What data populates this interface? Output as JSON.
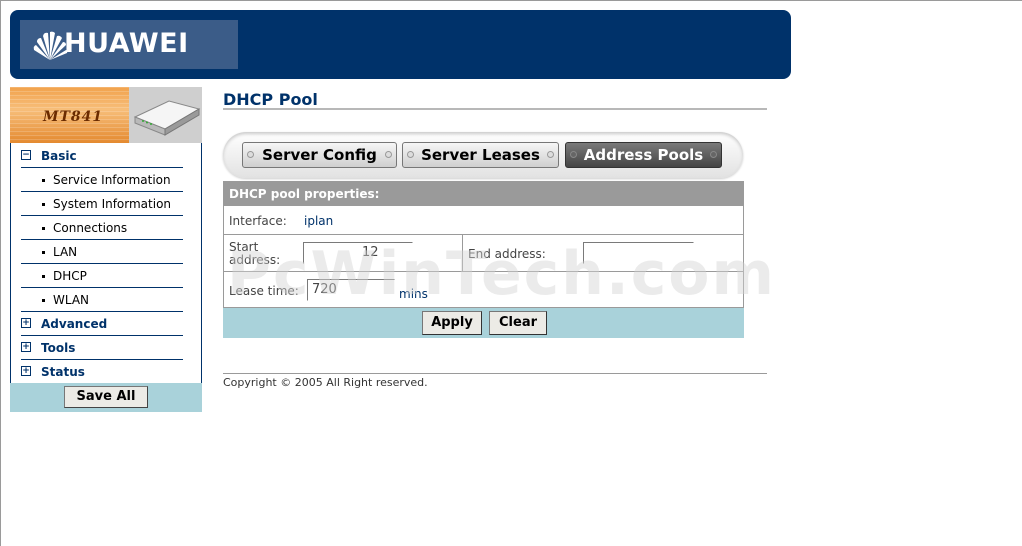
{
  "header": {
    "brand": "HUAWEI"
  },
  "device": {
    "model": "MT841"
  },
  "sidebar": {
    "sections": [
      {
        "label": "Basic",
        "state": "−"
      },
      {
        "label": "Advanced",
        "state": "+"
      },
      {
        "label": "Tools",
        "state": "+"
      },
      {
        "label": "Status",
        "state": "+"
      }
    ],
    "items": [
      {
        "label": "Service Information"
      },
      {
        "label": "System Information"
      },
      {
        "label": "Connections"
      },
      {
        "label": "LAN"
      },
      {
        "label": "DHCP"
      },
      {
        "label": "WLAN"
      }
    ],
    "save_all": "Save All"
  },
  "main": {
    "title": "DHCP Pool",
    "tabs": [
      {
        "label": "Server Config",
        "active": false
      },
      {
        "label": "Server Leases",
        "active": false
      },
      {
        "label": "Address Pools",
        "active": true
      }
    ],
    "properties": {
      "heading": "DHCP pool properties:",
      "interface_label": "Interface:",
      "interface_value": "iplan",
      "start_label": "Start address:",
      "start_value": "12",
      "end_label": "End address:",
      "lease_label": "Lease time:",
      "lease_value": "720",
      "lease_unit": "mins"
    },
    "buttons": {
      "apply": "Apply",
      "clear": "Clear"
    }
  },
  "footer": {
    "copyright": "Copyright © 2005 All Right reserved."
  },
  "watermark": "PcWinTech.com",
  "colors": {
    "navy": "#00326a",
    "teal_bar": "#a9d2da",
    "header_gray": "#9a9a9a"
  }
}
